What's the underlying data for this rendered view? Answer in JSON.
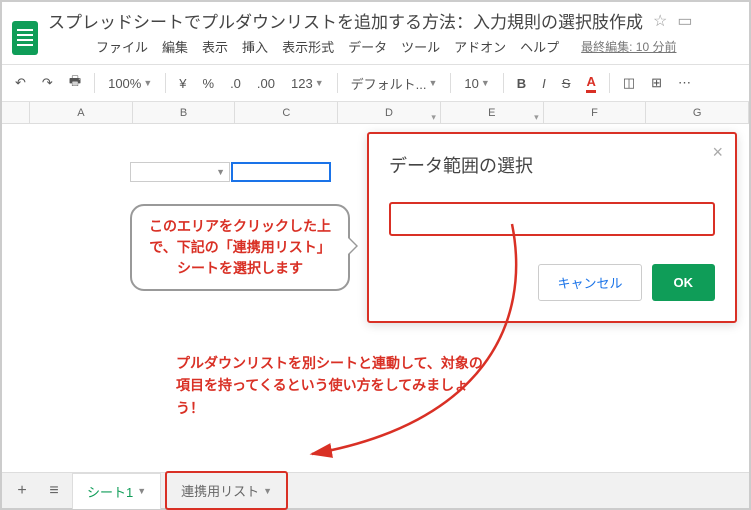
{
  "doc_title": "スプレッドシートでプルダウンリストを追加する方法：入力規則の選択肢作成",
  "menu": {
    "file": "ファイル",
    "edit": "編集",
    "view": "表示",
    "insert": "挿入",
    "format": "表示形式",
    "data": "データ",
    "tools": "ツール",
    "addons": "アドオン",
    "help": "ヘルプ",
    "last_edit": "最終編集: 10 分前"
  },
  "toolbar": {
    "zoom": "100%",
    "currency": "¥",
    "percent": "%",
    "dec_dec": ".0",
    "inc_dec": ".00",
    "more_fmt": "123",
    "font": "デフォルト...",
    "font_size": "10",
    "bold": "B",
    "italic": "I",
    "strike": "S",
    "text_color": "A"
  },
  "columns": [
    "A",
    "B",
    "C",
    "D",
    "E",
    "F",
    "G"
  ],
  "dialog": {
    "title": "データ範囲の選択",
    "cancel": "キャンセル",
    "ok": "OK"
  },
  "callout1": "このエリアをクリックした上で、下記の「連携用リスト」シートを選択します",
  "callout2": "プルダウンリストを別シートと連動して、対象の項目を持ってくるという使い方をしてみましょう！",
  "tabs": {
    "add": "+",
    "all": "≡",
    "sheet1": "シート1",
    "linked": "連携用リスト"
  }
}
